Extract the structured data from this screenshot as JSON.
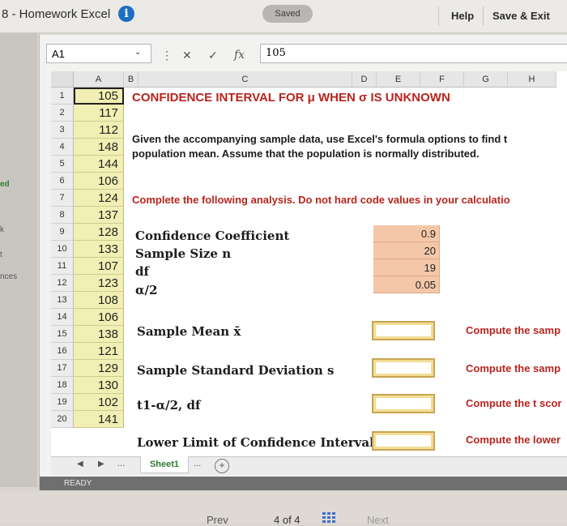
{
  "app": {
    "title": "8 - Homework Excel",
    "saved_label": "Saved",
    "help_label": "Help",
    "save_exit_label": "Save & Exit"
  },
  "side_labels": [
    "ed",
    "k",
    "t",
    "nces"
  ],
  "formula_bar": {
    "namebox": "A1",
    "dropdown_glyph": "⌄",
    "menu_glyph": "⋮",
    "cancel_glyph": "✕",
    "confirm_glyph": "✓",
    "fx_glyph": "fx",
    "value": "105"
  },
  "columns": [
    "A",
    "B",
    "C",
    "D",
    "E",
    "F",
    "G",
    "H"
  ],
  "rows": [
    "1",
    "2",
    "3",
    "4",
    "5",
    "6",
    "7",
    "8",
    "9",
    "10",
    "11",
    "12",
    "13",
    "14",
    "15",
    "16",
    "17",
    "18",
    "19",
    "20"
  ],
  "column_a_values": [
    "105",
    "117",
    "112",
    "148",
    "144",
    "106",
    "124",
    "137",
    "128",
    "133",
    "107",
    "123",
    "108",
    "106",
    "138",
    "121",
    "129",
    "130",
    "102",
    "141"
  ],
  "sheet": {
    "heading": "CONFIDENCE INTERVAL FOR μ WHEN σ IS UNKNOWN",
    "instructions_line1": "Given the accompanying sample data, use Excel's formula options to find t",
    "instructions_line2": "population mean. Assume that the population is normally distributed.",
    "analysis_prompt": "Complete the following analysis. Do not hard code values in your calculatio",
    "params": [
      {
        "label": "Confidence Coefficient",
        "value": "0.9"
      },
      {
        "label": "Sample Size n",
        "value": "20"
      },
      {
        "label": "df",
        "value": "19"
      },
      {
        "label": "α/2",
        "value": "0.05"
      }
    ],
    "computations": [
      {
        "label": "Sample Mean x̄",
        "hint": "Compute the samp"
      },
      {
        "label": "Sample Standard Deviation s",
        "hint": "Compute the samp"
      },
      {
        "label": "t1-α/2, df",
        "hint": "Compute the t scor"
      },
      {
        "label": "Lower Limit of Confidence Interval",
        "hint": "Compute the lower"
      }
    ]
  },
  "tabs": {
    "prev_arrow": "◀",
    "next_arrow": "▶",
    "more": "...",
    "sheet_name": "Sheet1",
    "more2": "...",
    "add": "+"
  },
  "status": "READY",
  "nav": {
    "prev": "Prev",
    "page": "4 of 4",
    "next": "Next"
  },
  "colors": {
    "accent_blue": "#1d6fc4",
    "heading_red": "#b8241e",
    "data_yellow": "#f1efb3",
    "param_orange": "#f4c7a8",
    "input_gold": "#f3dd95"
  }
}
